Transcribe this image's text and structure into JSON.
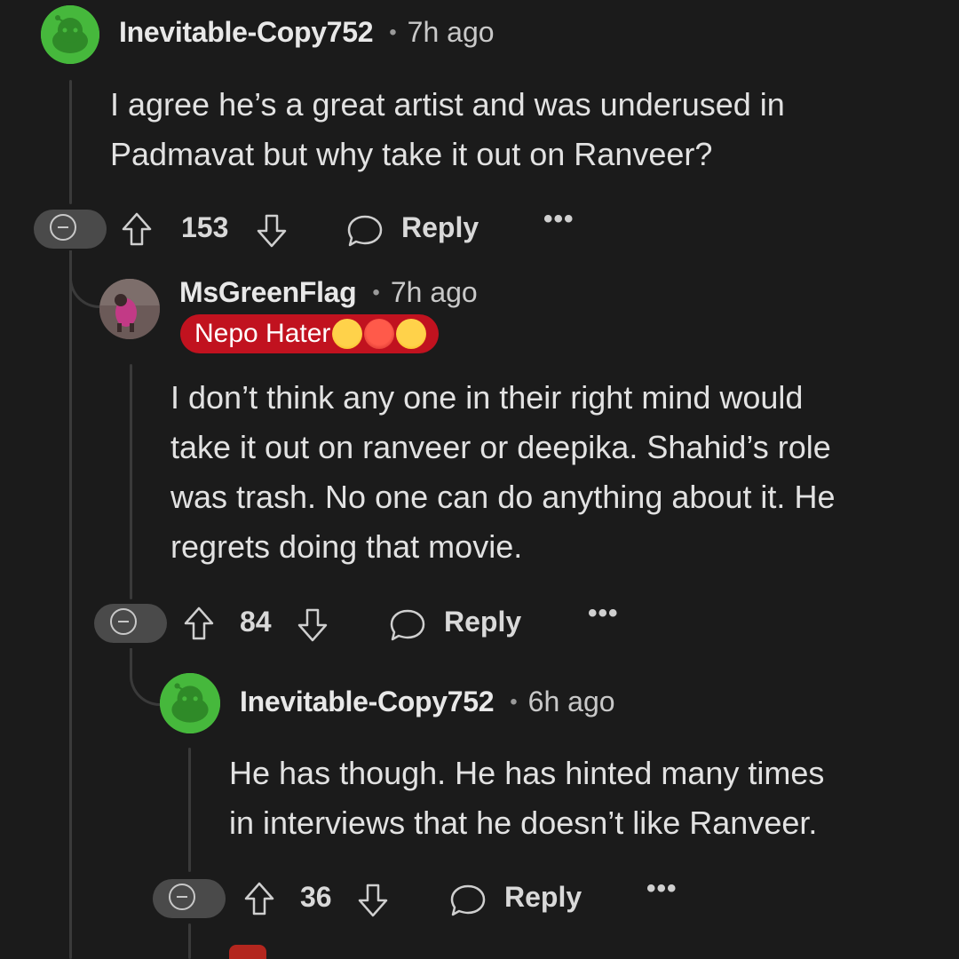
{
  "comments": [
    {
      "username": "Inevitable-Copy752",
      "time": "7h ago",
      "body": [
        "I agree he’s a great artist and was underused in",
        "Padmavat but why take it out on Ranveer?"
      ],
      "score": "153",
      "reply_label": "Reply",
      "more_label": "•••"
    },
    {
      "username": "MsGreenFlag",
      "time": "7h ago",
      "flair": "Nepo Hater",
      "body": [
        "I don’t think any one in their right mind would",
        "take it out on ranveer or deepika. Shahid’s role",
        "was trash. No one can do anything about it. He",
        "regrets doing that movie."
      ],
      "score": "84",
      "reply_label": "Reply",
      "more_label": "•••"
    },
    {
      "username": "Inevitable-Copy752",
      "time": "6h ago",
      "body": [
        "He has though. He has hinted many times",
        "in interviews that he doesn’t like Ranveer."
      ],
      "score": "36",
      "reply_label": "Reply",
      "more_label": "•••"
    }
  ],
  "separator": "•",
  "colors": {
    "background": "#1b1b1b",
    "flair_bg": "#c1121f",
    "snoo_green": "#46b83c"
  }
}
